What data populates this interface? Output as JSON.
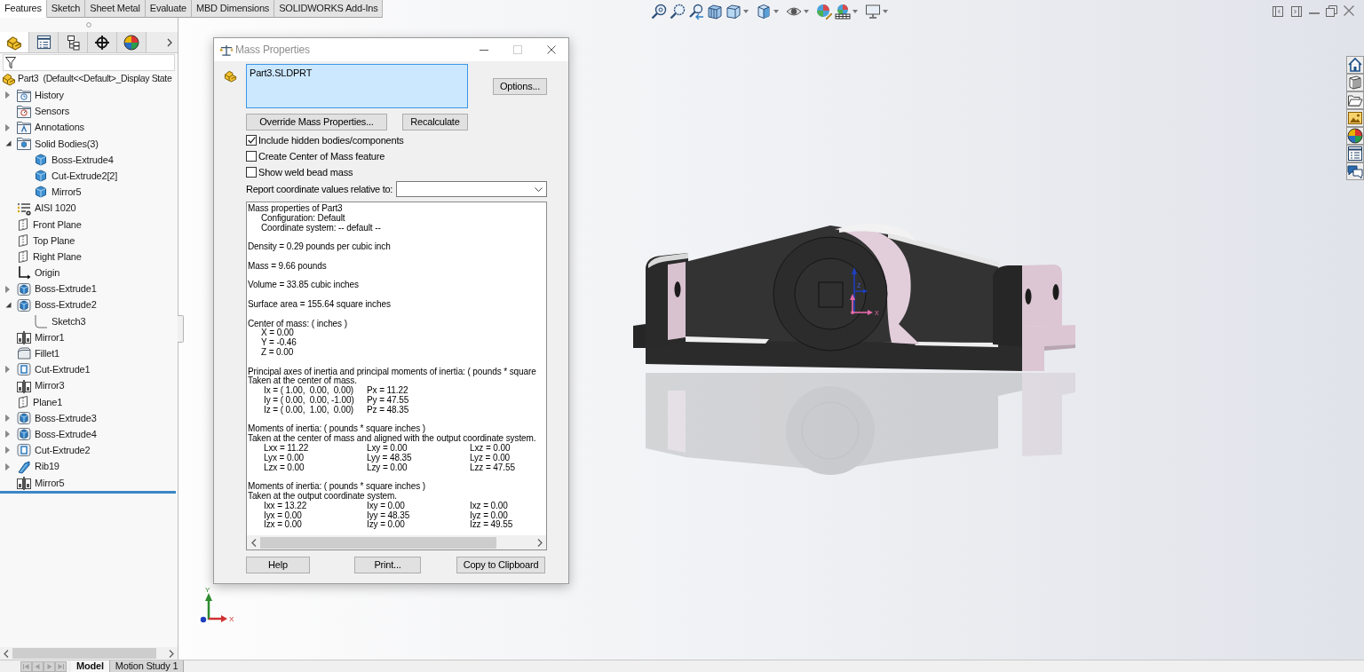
{
  "command_tabs": [
    {
      "label": "Features",
      "selected": true
    },
    {
      "label": "Sketch",
      "selected": false
    },
    {
      "label": "Sheet Metal",
      "selected": false
    },
    {
      "label": "Evaluate",
      "selected": false
    },
    {
      "label": "MBD Dimensions",
      "selected": false
    },
    {
      "label": "SOLIDWORKS Add-Ins",
      "selected": false
    }
  ],
  "panel_tabs": [
    {
      "selected": true
    },
    {
      "selected": false
    },
    {
      "selected": false
    },
    {
      "selected": false
    },
    {
      "selected": false
    }
  ],
  "tree": {
    "label": "Part3  (Default<<Default>_Display State",
    "kind": "part",
    "children": [
      {
        "label": "History",
        "kind": "history",
        "expanded": false
      },
      {
        "label": "Sensors",
        "kind": "sensors"
      },
      {
        "label": "Annotations",
        "kind": "annotations",
        "expanded": false
      },
      {
        "label": "Solid Bodies(3)",
        "kind": "bodies",
        "expanded": true,
        "children": [
          {
            "label": "Boss-Extrude4",
            "kind": "body"
          },
          {
            "label": "Cut-Extrude2[2]",
            "kind": "body"
          },
          {
            "label": "Mirror5",
            "kind": "body"
          }
        ]
      },
      {
        "label": "AISI 1020",
        "kind": "material"
      },
      {
        "label": "Front Plane",
        "kind": "plane"
      },
      {
        "label": "Top Plane",
        "kind": "plane"
      },
      {
        "label": "Right Plane",
        "kind": "plane"
      },
      {
        "label": "Origin",
        "kind": "origin"
      },
      {
        "label": "Boss-Extrude1",
        "kind": "extrude",
        "expanded": false
      },
      {
        "label": "Boss-Extrude2",
        "kind": "extrude",
        "expanded": true,
        "children": [
          {
            "label": "Sketch3",
            "kind": "sketch"
          }
        ]
      },
      {
        "label": "Mirror1",
        "kind": "mirror"
      },
      {
        "label": "Fillet1",
        "kind": "fillet"
      },
      {
        "label": "Cut-Extrude1",
        "kind": "cut",
        "expanded": false
      },
      {
        "label": "Mirror3",
        "kind": "mirror"
      },
      {
        "label": "Plane1",
        "kind": "plane"
      },
      {
        "label": "Boss-Extrude3",
        "kind": "extrude",
        "expanded": false
      },
      {
        "label": "Boss-Extrude4",
        "kind": "extrude",
        "expanded": false
      },
      {
        "label": "Cut-Extrude2",
        "kind": "cut",
        "expanded": false
      },
      {
        "label": "Rib19",
        "kind": "rib",
        "expanded": false
      },
      {
        "label": "Mirror5",
        "kind": "mirror"
      }
    ]
  },
  "bottom_tabs": [
    {
      "label": "Model",
      "selected": true
    },
    {
      "label": "Motion Study 1",
      "selected": false
    }
  ],
  "triad": {
    "y_label": "Y",
    "x_label": "X"
  },
  "reference_triad": {
    "z_label": "Z",
    "x_label": "X"
  },
  "dialog": {
    "title": "Mass Properties",
    "selection_list": [
      "Part3.SLDPRT"
    ],
    "options_button": "Options...",
    "override_button": "Override Mass Properties...",
    "recalculate_button": "Recalculate",
    "checkboxes": [
      {
        "label": "Include hidden bodies/components",
        "checked": true
      },
      {
        "label": "Create Center of Mass feature",
        "checked": false
      },
      {
        "label": "Show weld bead mass",
        "checked": false
      }
    ],
    "coordinate_label": "Report coordinate values relative to:",
    "report": [
      {
        "lines": [
          "Mass properties of Part3"
        ],
        "details": [
          "Configuration: Default",
          "Coordinate system: -- default --"
        ]
      },
      {
        "lines": [
          "Density = 0.29 pounds per cubic inch"
        ]
      },
      {
        "lines": [
          "Mass = 9.66 pounds"
        ]
      },
      {
        "lines": [
          "Volume = 33.85 cubic inches"
        ]
      },
      {
        "lines": [
          "Surface area = 155.64 square inches"
        ]
      },
      {
        "lines": [
          "Center of mass: ( inches )"
        ],
        "details": [
          "X = 0.00",
          "Y = -0.46",
          "Z = 0.00"
        ]
      },
      {
        "lines": [
          "Principal axes of inertia and principal moments of inertia: ( pounds * square",
          "Taken at the center of mass."
        ],
        "rows": [
          [
            "Ix = ( 1.00,  0.00,  0.00)",
            "Px = 11.22"
          ],
          [
            "Iy = ( 0.00,  0.00, -1.00)",
            "Py = 47.55"
          ],
          [
            "Iz = ( 0.00,  1.00,  0.00)",
            "Pz = 48.35"
          ]
        ]
      },
      {
        "lines": [
          "Moments of inertia: ( pounds * square inches )",
          "Taken at the center of mass and aligned with the output coordinate system."
        ],
        "rows": [
          [
            "Lxx = 11.22",
            "Lxy = 0.00",
            "Lxz = 0.00"
          ],
          [
            "Lyx = 0.00",
            "Lyy = 48.35",
            "Lyz = 0.00"
          ],
          [
            "Lzx = 0.00",
            "Lzy = 0.00",
            "Lzz = 47.55"
          ]
        ]
      },
      {
        "lines": [
          "Moments of inertia: ( pounds * square inches )",
          "Taken at the output coordinate system."
        ],
        "rows": [
          [
            "Ixx = 13.22",
            "Ixy = 0.00",
            "Ixz = 0.00"
          ],
          [
            "Iyx = 0.00",
            "Iyy = 48.35",
            "Iyz = 0.00"
          ],
          [
            "Izx = 0.00",
            "Izy = 0.00",
            "Izz = 49.55"
          ]
        ]
      }
    ],
    "footer_buttons": [
      "Help",
      "Print...",
      "Copy to Clipboard"
    ]
  }
}
